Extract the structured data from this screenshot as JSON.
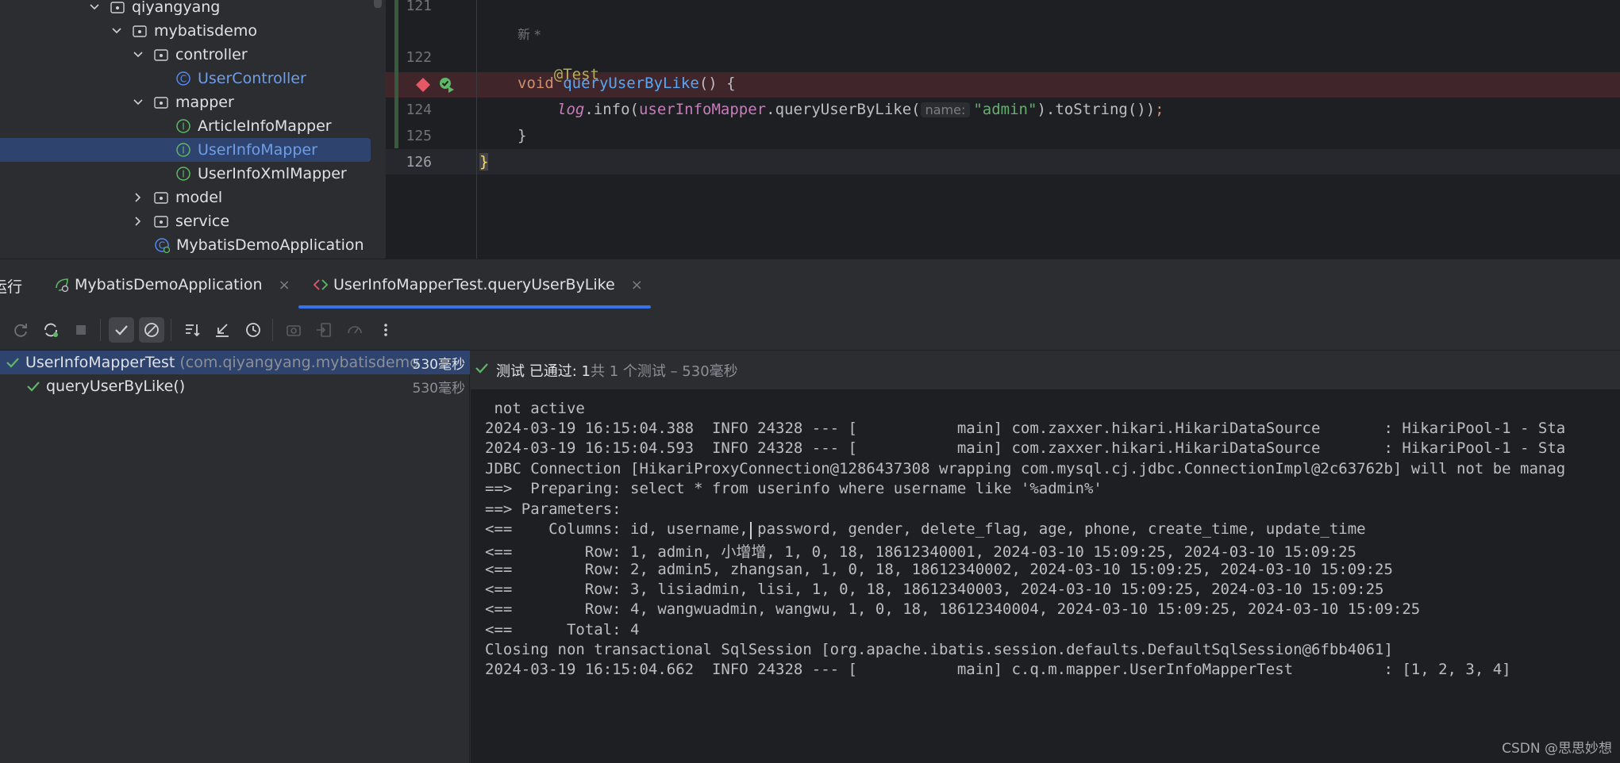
{
  "project_tree": {
    "items": [
      {
        "label": "qiyangyang",
        "kind": "package",
        "expanded": true
      },
      {
        "label": "mybatisdemo",
        "kind": "package",
        "expanded": true
      },
      {
        "label": "controller",
        "kind": "package",
        "expanded": true
      },
      {
        "label": "UserController",
        "kind": "class"
      },
      {
        "label": "mapper",
        "kind": "package",
        "expanded": true
      },
      {
        "label": "ArticleInfoMapper",
        "kind": "interface"
      },
      {
        "label": "UserInfoMapper",
        "kind": "interface",
        "selected": true
      },
      {
        "label": "UserInfoXmlMapper",
        "kind": "interface"
      },
      {
        "label": "model",
        "kind": "package",
        "expanded": false
      },
      {
        "label": "service",
        "kind": "package",
        "expanded": false
      },
      {
        "label": "MybatisDemoApplication",
        "kind": "spring-boot-class"
      }
    ]
  },
  "editor": {
    "line_numbers": [
      "121",
      "122",
      "124",
      "125",
      "126"
    ],
    "new_hint": "新 *",
    "annotation": "@Test",
    "kw_void": "void",
    "method_name": "queryUserByLike",
    "decl_rest": "() {",
    "log_var": "log",
    "info_call": ".info(",
    "mapper_field": "userInfoMapper",
    "mapper_call": ".queryUserByLike(",
    "param_hint": "name:",
    "string_arg": "\"admin\"",
    "call_tail": ").toString())",
    "semicolon": ";",
    "close_brace_inner": "}",
    "close_brace_outer": "}"
  },
  "tool_window": {
    "title": "运行",
    "tabs": [
      {
        "label": "MybatisDemoApplication",
        "close": "×"
      },
      {
        "label": "UserInfoMapperTest.queryUserByLike",
        "close": "×"
      }
    ]
  },
  "toolbar": {
    "icons": [
      "rerun-icon",
      "rerun-failed-icon",
      "stop-icon",
      "show-passed-icon",
      "show-ignored-icon",
      "sort-icon",
      "collapse-icon",
      "history-icon",
      "screenshot-icon",
      "import-icon",
      "coverage-icon",
      "more-icon"
    ]
  },
  "test_tree": {
    "root": {
      "name": "UserInfoMapperTest",
      "package": "(com.qiyangyang.mybatisdemo",
      "duration": "530毫秒"
    },
    "child": {
      "name": "queryUserByLike()",
      "duration": "530毫秒"
    }
  },
  "status": {
    "passed_text": "测试 已通过: 1",
    "count_text": "共 1 个测试 – 530毫秒"
  },
  "console": {
    "lines": [
      " not active",
      "2024-03-19 16:15:04.388  INFO 24328 --- [           main] com.zaxxer.hikari.HikariDataSource       : HikariPool-1 - Sta",
      "2024-03-19 16:15:04.593  INFO 24328 --- [           main] com.zaxxer.hikari.HikariDataSource       : HikariPool-1 - Sta",
      "JDBC Connection [HikariProxyConnection@1286437308 wrapping com.mysql.cj.jdbc.ConnectionImpl@2c63762b] will not be manag",
      "==>  Preparing: select * from userinfo where username like '%admin%'",
      "==> Parameters: ",
      "<==    Columns: id, username, password, gender, delete_flag, age, phone, create_time, update_time",
      "<==        Row: 1, admin, 小增增, 1, 0, 18, 18612340001, 2024-03-10 15:09:25, 2024-03-10 15:09:25",
      "<==        Row: 2, admin5, zhangsan, 1, 0, 18, 18612340002, 2024-03-10 15:09:25, 2024-03-10 15:09:25",
      "<==        Row: 3, lisiadmin, lisi, 1, 0, 18, 18612340003, 2024-03-10 15:09:25, 2024-03-10 15:09:25",
      "<==        Row: 4, wangwuadmin, wangwu, 1, 0, 18, 18612340004, 2024-03-10 15:09:25, 2024-03-10 15:09:25",
      "<==      Total: 4",
      "Closing non transactional SqlSession [org.apache.ibatis.session.defaults.DefaultSqlSession@6fbb4061]",
      "2024-03-19 16:15:04.662  INFO 24328 --- [           main] c.q.m.mapper.UserInfoMapperTest          : [1, 2, 3, 4]"
    ]
  },
  "watermark": "CSDN @思思妙想",
  "colors": {
    "accent": "#3574f0",
    "pass_green": "#5fb865",
    "breakpoint_red": "#e55765",
    "selection": "#2e436e"
  }
}
